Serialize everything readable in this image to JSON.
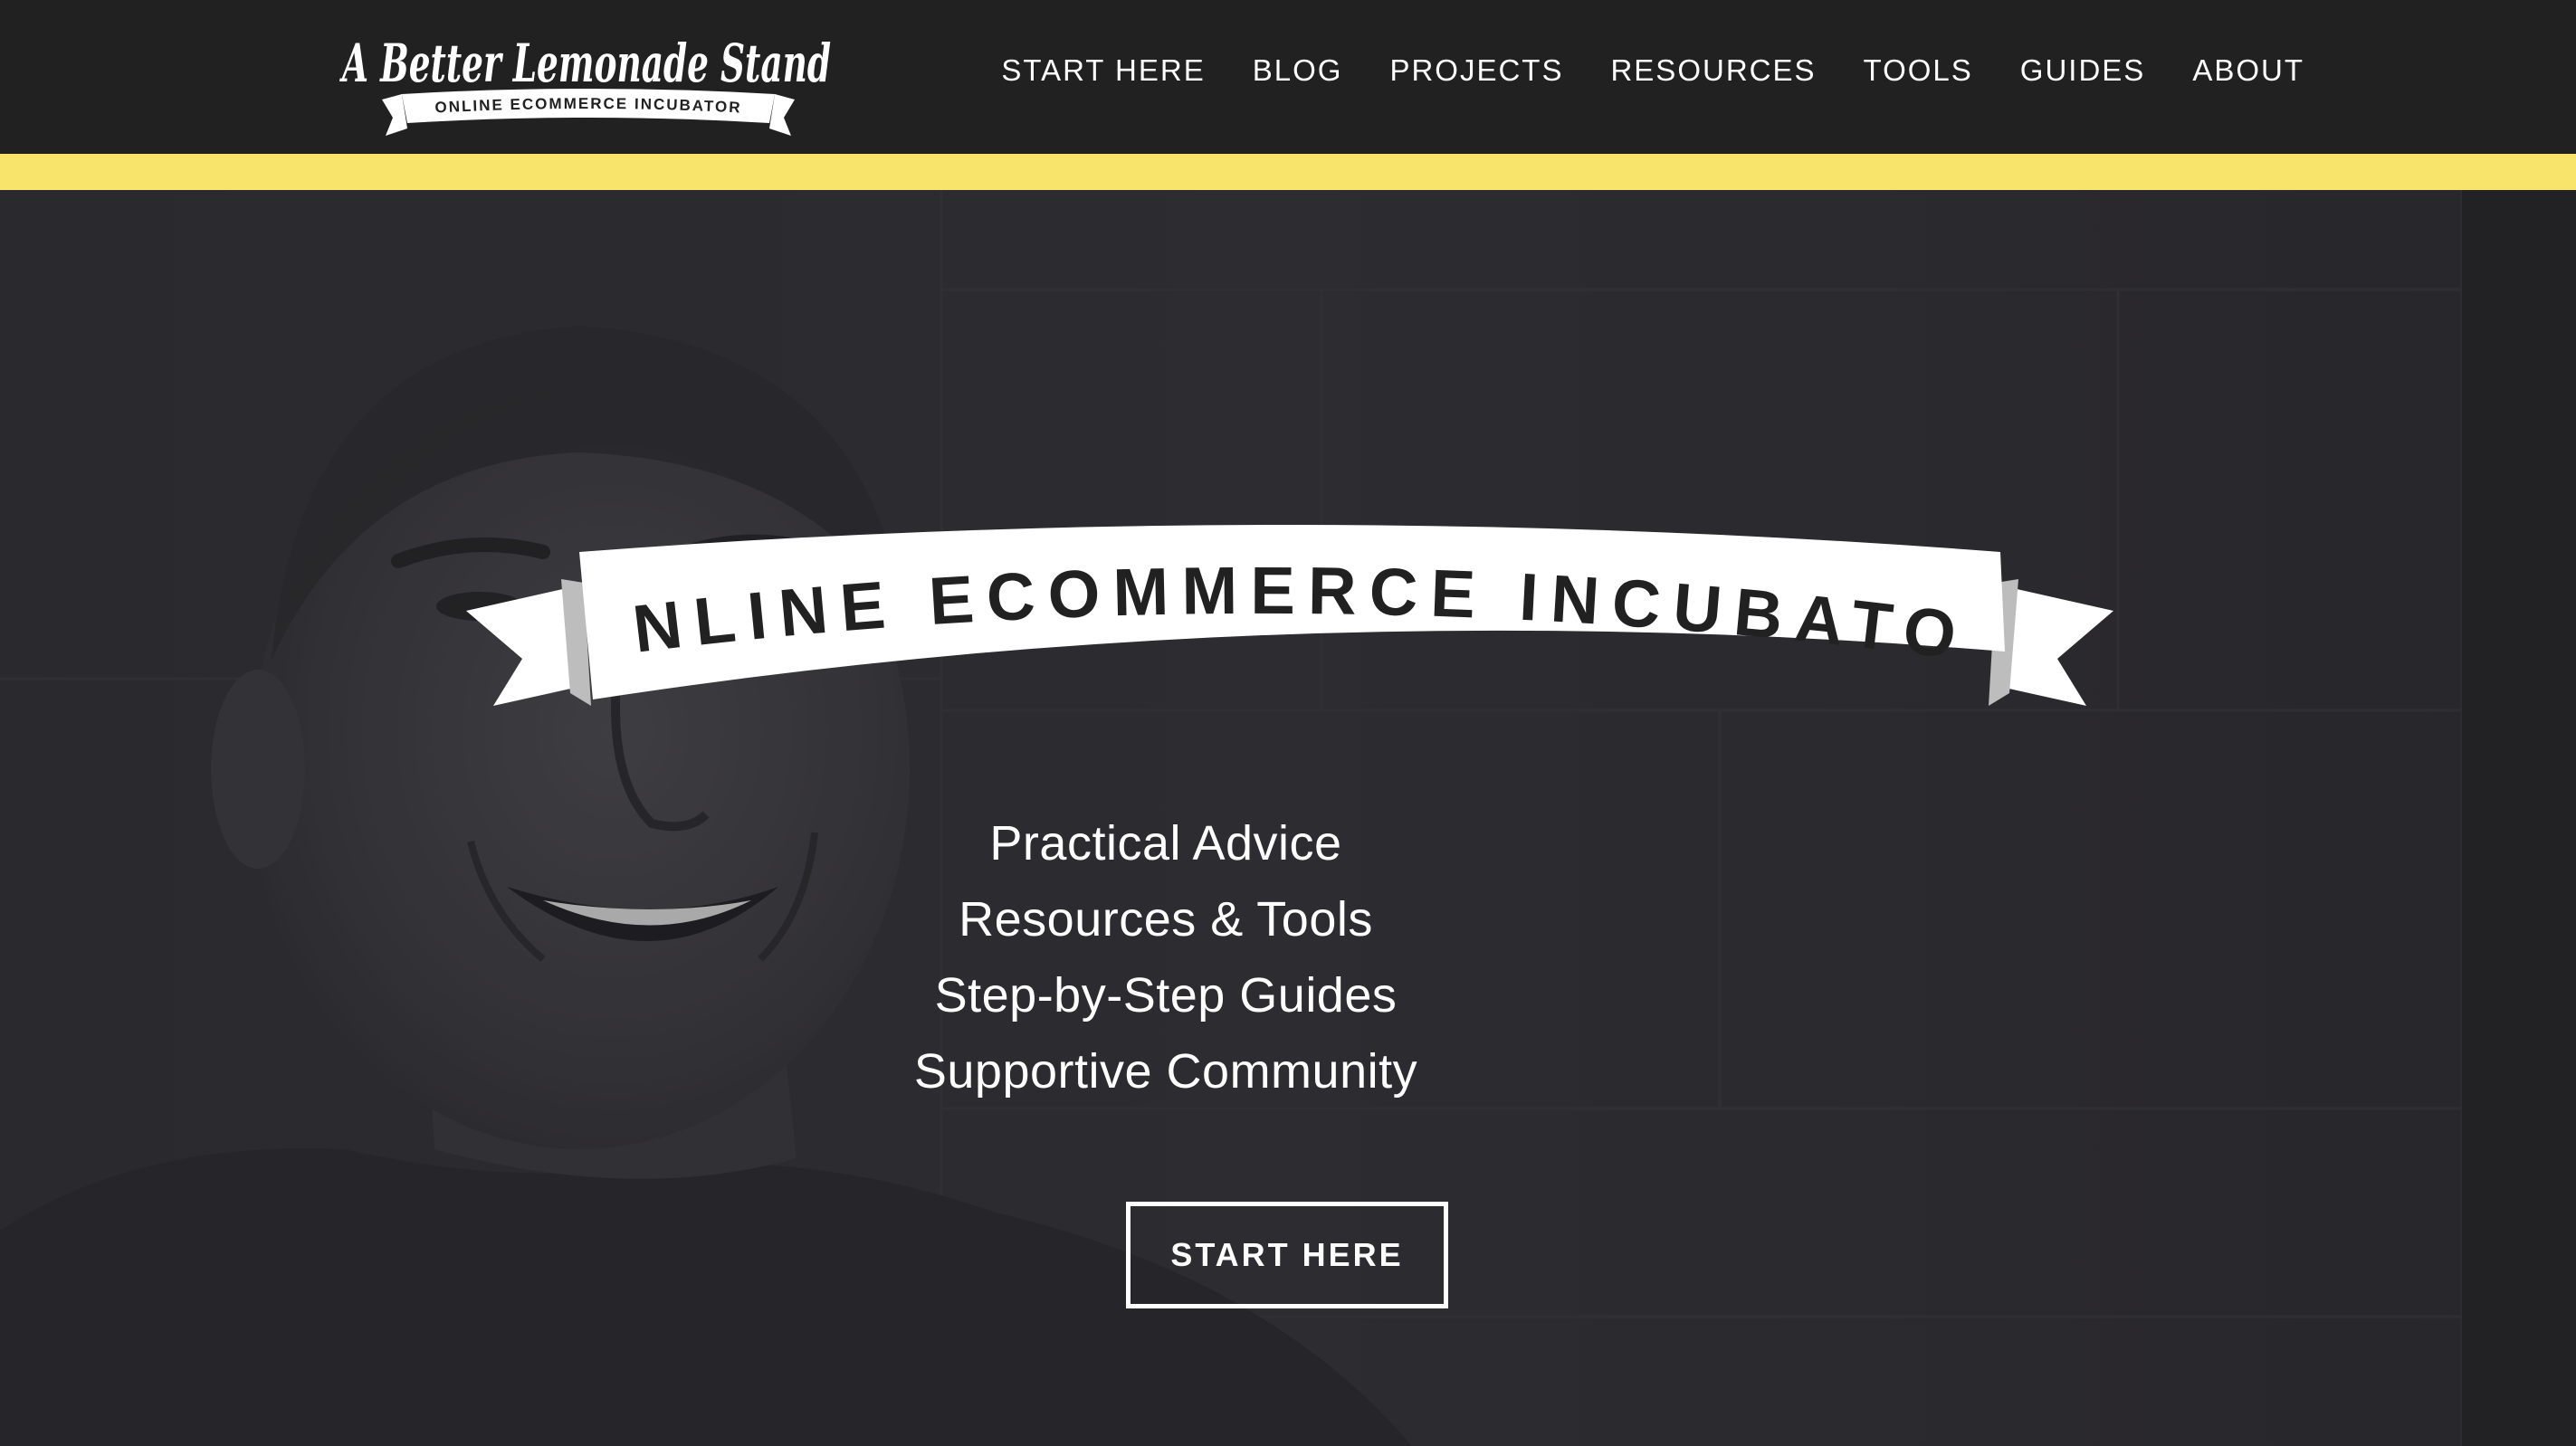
{
  "header": {
    "logo": {
      "title": "A Better Lemonade Stand",
      "tagline": "ONLINE ECOMMERCE INCUBATOR"
    },
    "nav": [
      {
        "label": "START HERE"
      },
      {
        "label": "BLOG"
      },
      {
        "label": "PROJECTS"
      },
      {
        "label": "RESOURCES"
      },
      {
        "label": "TOOLS"
      },
      {
        "label": "GUIDES"
      },
      {
        "label": "ABOUT"
      }
    ]
  },
  "hero": {
    "banner_text": "ONLINE ECOMMERCE INCUBATOR",
    "lines": [
      "Practical Advice",
      "Resources & Tools",
      "Step-by-Step Guides",
      "Supportive Community"
    ],
    "cta_label": "START HERE"
  },
  "colors": {
    "header_bg": "#212121",
    "accent_yellow": "#f8e46b",
    "hero_overlay": "#2e2d31",
    "text": "#ffffff"
  }
}
